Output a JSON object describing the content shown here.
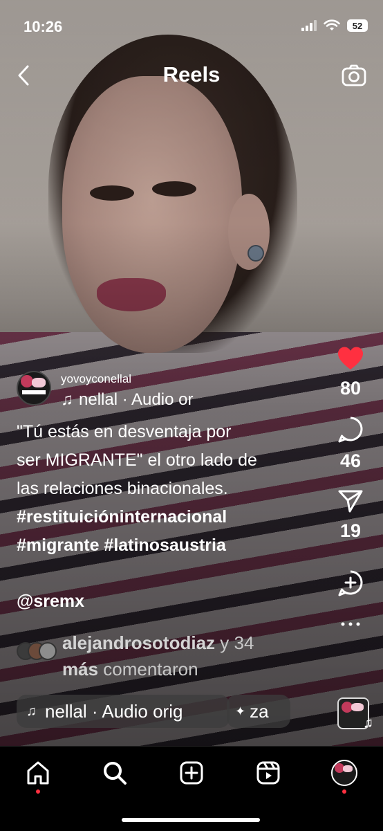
{
  "status_bar": {
    "time": "10:26",
    "battery": "52"
  },
  "header": {
    "title": "Reels"
  },
  "post": {
    "username": "yovoyconellal",
    "audio_line": "nellal · Audio or",
    "caption_lines": [
      "\"Tú estás en desventaja por",
      "ser MIGRANTE\" el otro lado de",
      "las relaciones binacionales."
    ],
    "hashtags_line1": "#restituicióninternacional",
    "hashtags_line2": "#migrante  #latinosaustria",
    "mention": "@sremx",
    "commenters_user": "alejandrosotodiaz",
    "commenters_rest1": " y 34",
    "commenters_more": "más",
    "commenters_rest2": " comentaron"
  },
  "actions": {
    "likes": "80",
    "comments": "46",
    "shares": "19"
  },
  "bottom_pills": {
    "audio_label": "nellal · Audio orig",
    "effect_label": "za"
  },
  "colors": {
    "like": "#ff3040",
    "nav_dot": "#ff3040"
  },
  "nav": {
    "items": [
      "home-icon",
      "search-icon",
      "create-icon",
      "reels-icon",
      "profile-avatar"
    ]
  }
}
